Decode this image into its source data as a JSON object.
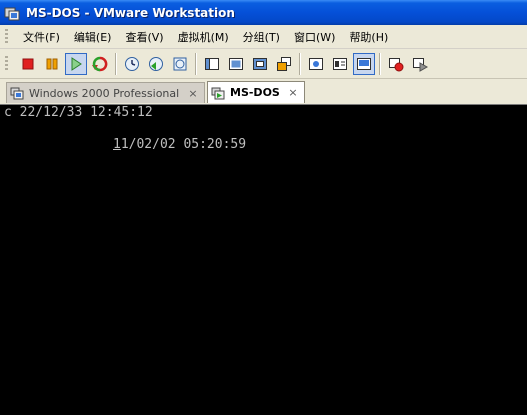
{
  "window": {
    "title": "MS-DOS - VMware Workstation"
  },
  "menu": [
    {
      "label": "文件(F)"
    },
    {
      "label": "编辑(E)"
    },
    {
      "label": "查看(V)"
    },
    {
      "label": "虚拟机(M)"
    },
    {
      "label": "分组(T)"
    },
    {
      "label": "窗口(W)"
    },
    {
      "label": "帮助(H)"
    }
  ],
  "toolbar": {
    "groups": [
      [
        "stop-icon",
        "pause-icon",
        "play-icon",
        "reset-icon"
      ],
      [
        "snapshot-icon",
        "revert-snapshot-icon",
        "snapshot-manager-icon"
      ],
      [
        "sidebar-icon",
        "quick-switch-icon",
        "fullscreen-icon",
        "unity-icon"
      ],
      [
        "summary-icon",
        "console-view-icon",
        "thumbnail-icon"
      ],
      [
        "record-icon",
        "replay-icon"
      ]
    ],
    "colors": {
      "stop": "#e02020",
      "pause": "#f0a000",
      "play": "#2aa02a",
      "reset": "#d02020"
    }
  },
  "tabs": [
    {
      "label": "Windows 2000 Professional",
      "active": false,
      "close": "×"
    },
    {
      "label": "MS-DOS",
      "active": true,
      "close": "×"
    }
  ],
  "console": {
    "line1": "c 22/12/33 12:45:12",
    "line2_cursor": "1",
    "line2_rest": "1/02/02 05:20:59",
    "text_color": "#bfbfbf",
    "background": "#000000"
  }
}
